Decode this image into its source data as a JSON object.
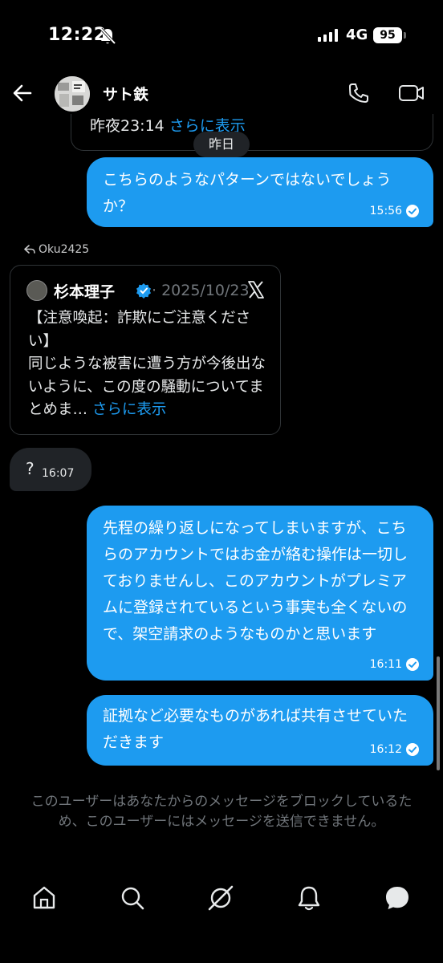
{
  "status_bar": {
    "time": "12:22",
    "network": "4G",
    "battery": "95"
  },
  "header": {
    "contact_name": "サト鉄"
  },
  "previous_message": {
    "text": "昨夜23:14",
    "more_link": "さらに表示"
  },
  "date_separator": "昨日",
  "messages": [
    {
      "text": "こちらのようなパターンではないでしょうか？",
      "time": "15:56"
    },
    {
      "text": "先程の繰り返しになってしまいますが、こちらのアカウントではお金が絡む操作は一切しておりませんし、このアカウントがプレミアムに登録されているという事実も全くないので、架空請求のようなものかと思います",
      "time": "16:11"
    },
    {
      "text": "証拠など必要なものがあれば共有させていただきます",
      "time": "16:12"
    }
  ],
  "reply": {
    "label": "Oku2425"
  },
  "quoted_post": {
    "author": "杉本理子",
    "date": "· 2025/10/23",
    "body": "【注意喚起：詐欺にご注意ください】\n同じような被害に遭う方が今後出ないように、この度の騒動についてまとめま…",
    "more_link": "さらに表示"
  },
  "received": {
    "text": "?",
    "time": "16:07"
  },
  "blocked_notice": "このユーザーはあなたからのメッセージをブロックしているため、このユーザーにはメッセージを送信できません。",
  "nav": [
    "home-icon",
    "search-icon",
    "grok-icon",
    "notifications-icon",
    "messages-icon"
  ],
  "colors": {
    "accent": "#1d9bf0",
    "background": "#000000",
    "incoming_bubble": "#202327",
    "muted_text": "#71767b"
  }
}
